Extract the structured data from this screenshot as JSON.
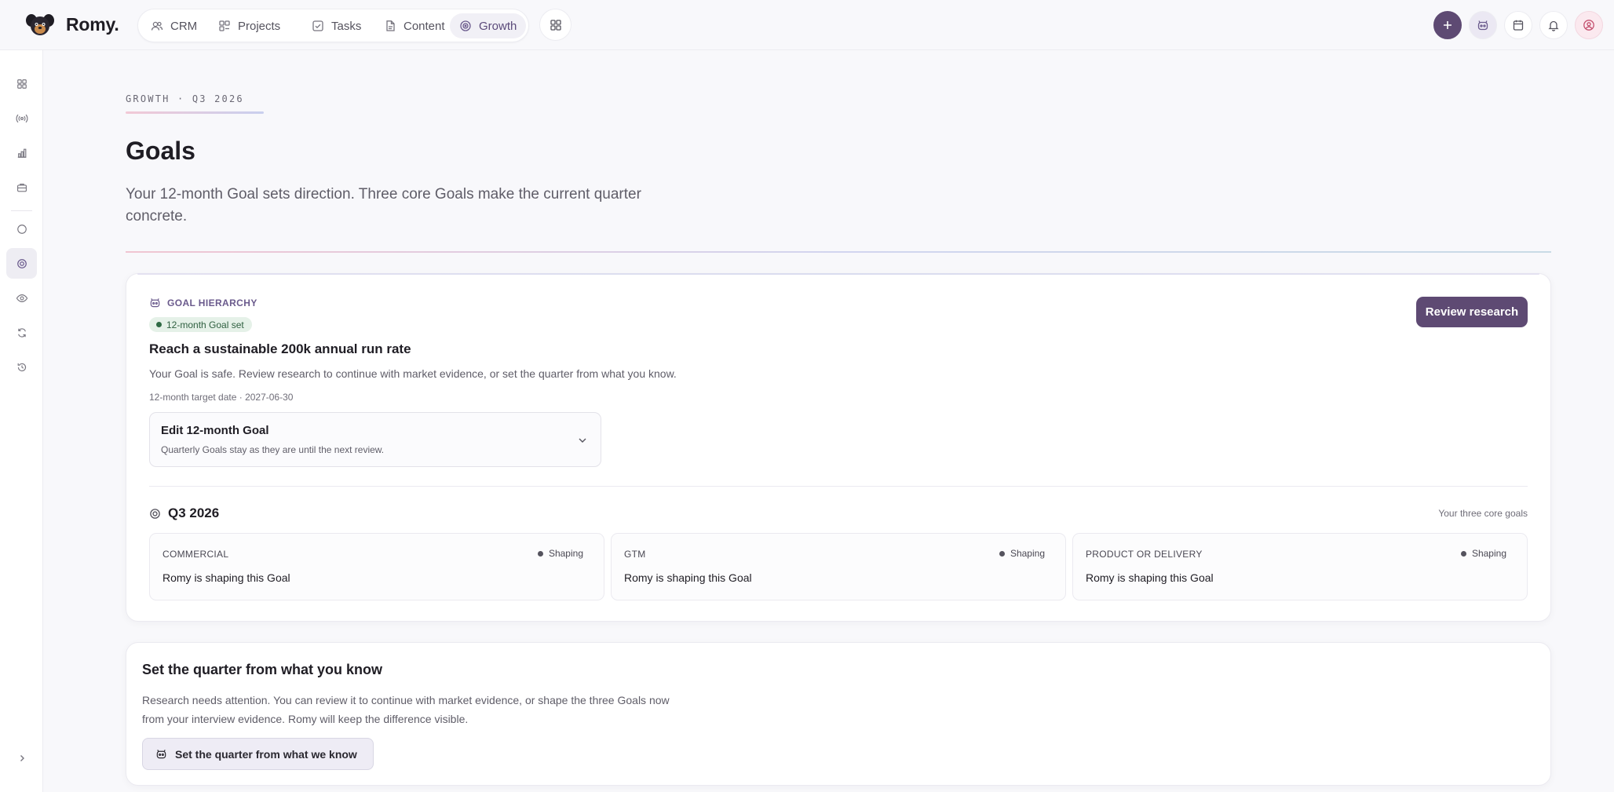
{
  "brand": {
    "name": "Romy."
  },
  "nav": {
    "items": [
      {
        "label": "CRM",
        "icon": "users-icon"
      },
      {
        "label": "Projects",
        "icon": "projects-icon"
      },
      {
        "label": "Tasks",
        "icon": "tasks-icon"
      },
      {
        "label": "Content",
        "icon": "document-icon"
      },
      {
        "label": "Growth",
        "icon": "target-icon",
        "active": true
      }
    ],
    "apps_icon": "apps-grid-icon"
  },
  "top_actions": [
    "plus-icon",
    "robot-icon",
    "calendar-icon",
    "bell-icon",
    "user-icon"
  ],
  "rail": [
    "dashboard-icon",
    "broadcast-icon",
    "bar-chart-icon",
    "briefcase-icon",
    "circle-icon",
    "target-icon",
    "eye-icon",
    "refresh-icon",
    "history-icon",
    "chevron-right-icon"
  ],
  "header": {
    "eyebrow": "GROWTH · Q3 2026",
    "title": "Goals",
    "subtitle": "Your 12-month Goal sets direction. Three core Goals make the current quarter concrete."
  },
  "hierarchy": {
    "kicker": "GOAL HIERARCHY",
    "status": "12-month Goal set",
    "goal_title": "Reach a sustainable 200k annual run rate",
    "goal_description": "Your Goal is safe. Review research to continue with market evidence, or set the quarter from what you know.",
    "target_date": "12-month target date · 2027-06-30",
    "review_button": "Review research",
    "edit": {
      "title": "Edit 12-month Goal",
      "subtitle": "Quarterly Goals stay as they are until the next review."
    },
    "quarter": {
      "label": "Q3 2026",
      "note": "Your three core goals",
      "goals": [
        {
          "category": "COMMERCIAL",
          "status": "Shaping",
          "text": "Romy is shaping this Goal"
        },
        {
          "category": "GTM",
          "status": "Shaping",
          "text": "Romy is shaping this Goal"
        },
        {
          "category": "PRODUCT OR DELIVERY",
          "status": "Shaping",
          "text": "Romy is shaping this Goal"
        }
      ]
    }
  },
  "set_quarter": {
    "title": "Set the quarter from what you know",
    "text": "Research needs attention. You can review it to continue with market evidence, or shape the three Goals now from your interview evidence. Romy will keep the difference visible.",
    "button": "Set the quarter from what we know"
  },
  "colors": {
    "accent": "#5e4a73",
    "accent_text": "#6a5a8c",
    "success_bg": "#e5f1e8",
    "success_text": "#2f6040"
  }
}
